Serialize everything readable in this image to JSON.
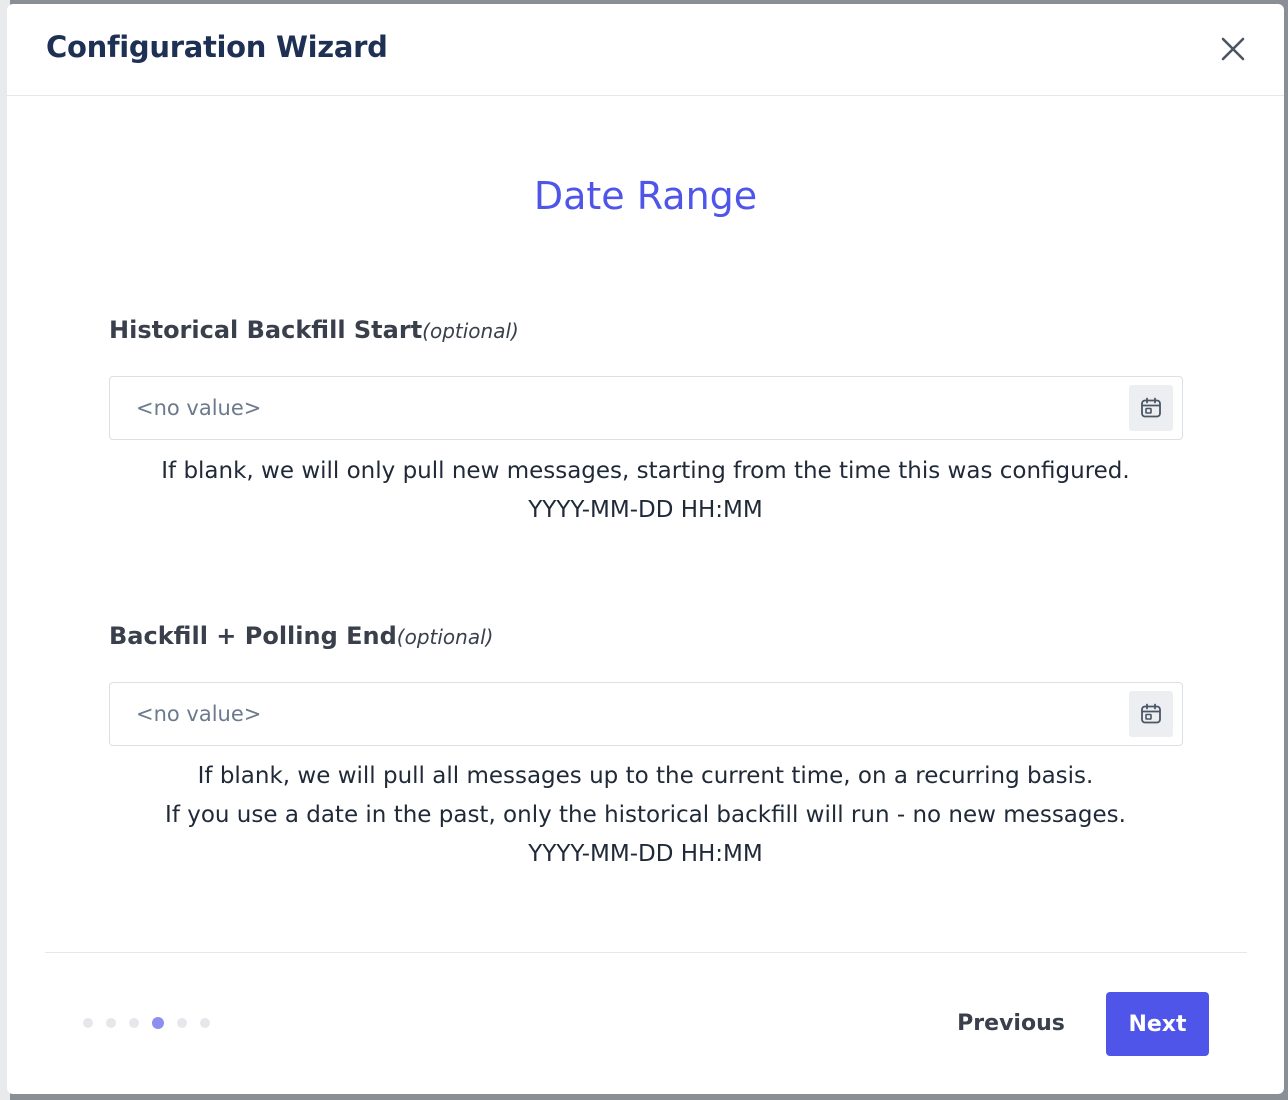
{
  "modal": {
    "title": "Configuration Wizard",
    "close_icon": "close-icon",
    "step_heading": "Date Range"
  },
  "fields": [
    {
      "label": "Historical Backfill Start",
      "optional": "(optional)",
      "placeholder": "<no value>",
      "value": "",
      "icon": "calendar-icon",
      "help": [
        "If blank, we will only pull new messages, starting from the time this was configured.",
        "YYYY-MM-DD HH:MM"
      ]
    },
    {
      "label": "Backfill + Polling End",
      "optional": "(optional)",
      "placeholder": "<no value>",
      "value": "",
      "icon": "calendar-icon",
      "help": [
        "If blank, we will pull all messages up to the current time, on a recurring basis.",
        "If you use a date in the past, only the historical backfill will run - no new messages.",
        "YYYY-MM-DD HH:MM"
      ]
    }
  ],
  "stepper": {
    "total_steps": 6,
    "current_step": 4
  },
  "footer": {
    "previous_label": "Previous",
    "next_label": "Next"
  },
  "colors": {
    "accent": "#4f55e8",
    "title": "#1e3054",
    "active_dot": "#8d8ff0"
  }
}
